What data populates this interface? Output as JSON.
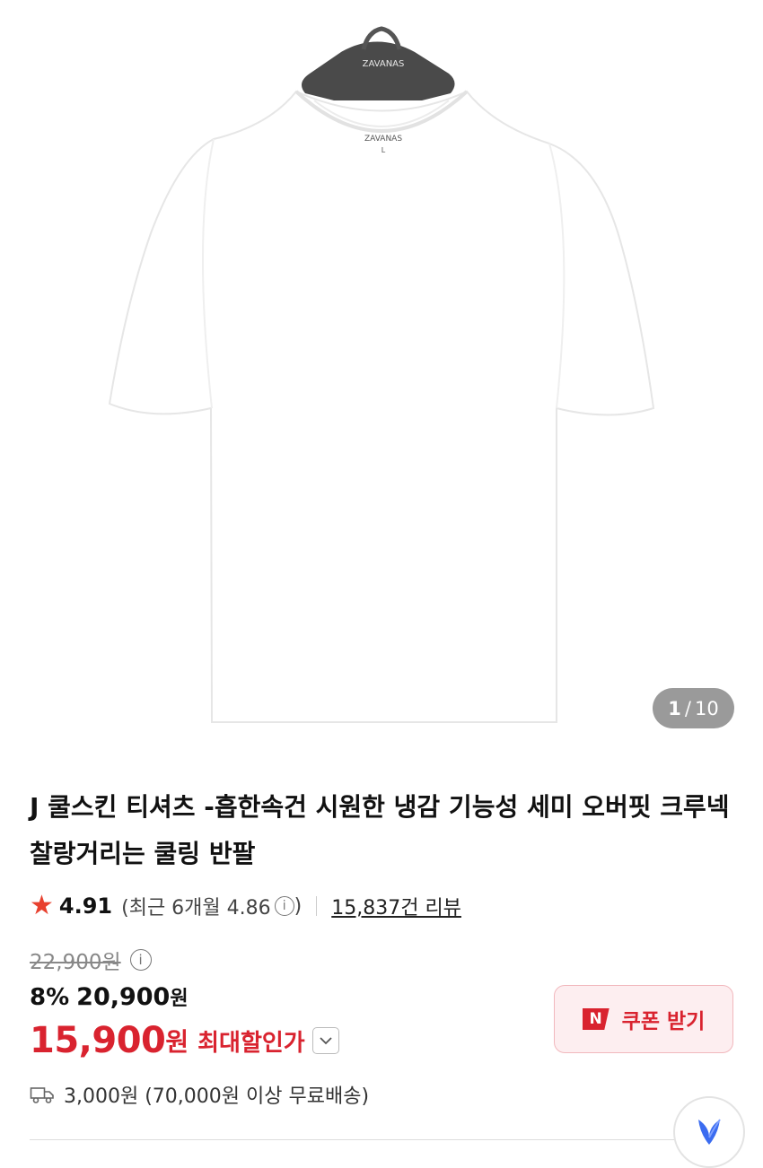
{
  "gallery": {
    "hanger_brand": "ZAVANAS",
    "tag_brand": "ZAVANAS",
    "tag_size": "L",
    "current": "1",
    "separator": "/",
    "total": "10"
  },
  "product": {
    "title": "J 쿨스킨 티셔츠 -흡한속건 시원한 냉감 기능성 세미 오버핏 크루넥 찰랑거리는 쿨링 반팔",
    "rating": "4.91",
    "recent_rating_label": "(최근 6개월 4.86",
    "recent_rating_close": ")",
    "review_count": "15,837건 리뷰",
    "original_price": "22,900원",
    "discount_percent": "8%",
    "sale_price": "20,900",
    "sale_price_unit": "원",
    "max_discount_price": "15,900",
    "max_discount_unit": "원",
    "max_discount_label": "최대할인가",
    "coupon_badge": "N",
    "coupon_button": "쿠폰 받기",
    "shipping": "3,000원 (70,000원 이상 무료배송)"
  },
  "colors": {
    "accent_red": "#d9232f",
    "star": "#e8412f",
    "coupon_bg": "#fdeef0",
    "pager_bg": "#9a9a9a"
  },
  "icons": [
    "star-icon",
    "info-icon",
    "chevron-down-icon",
    "truck-icon",
    "floating-assistant-icon"
  ]
}
